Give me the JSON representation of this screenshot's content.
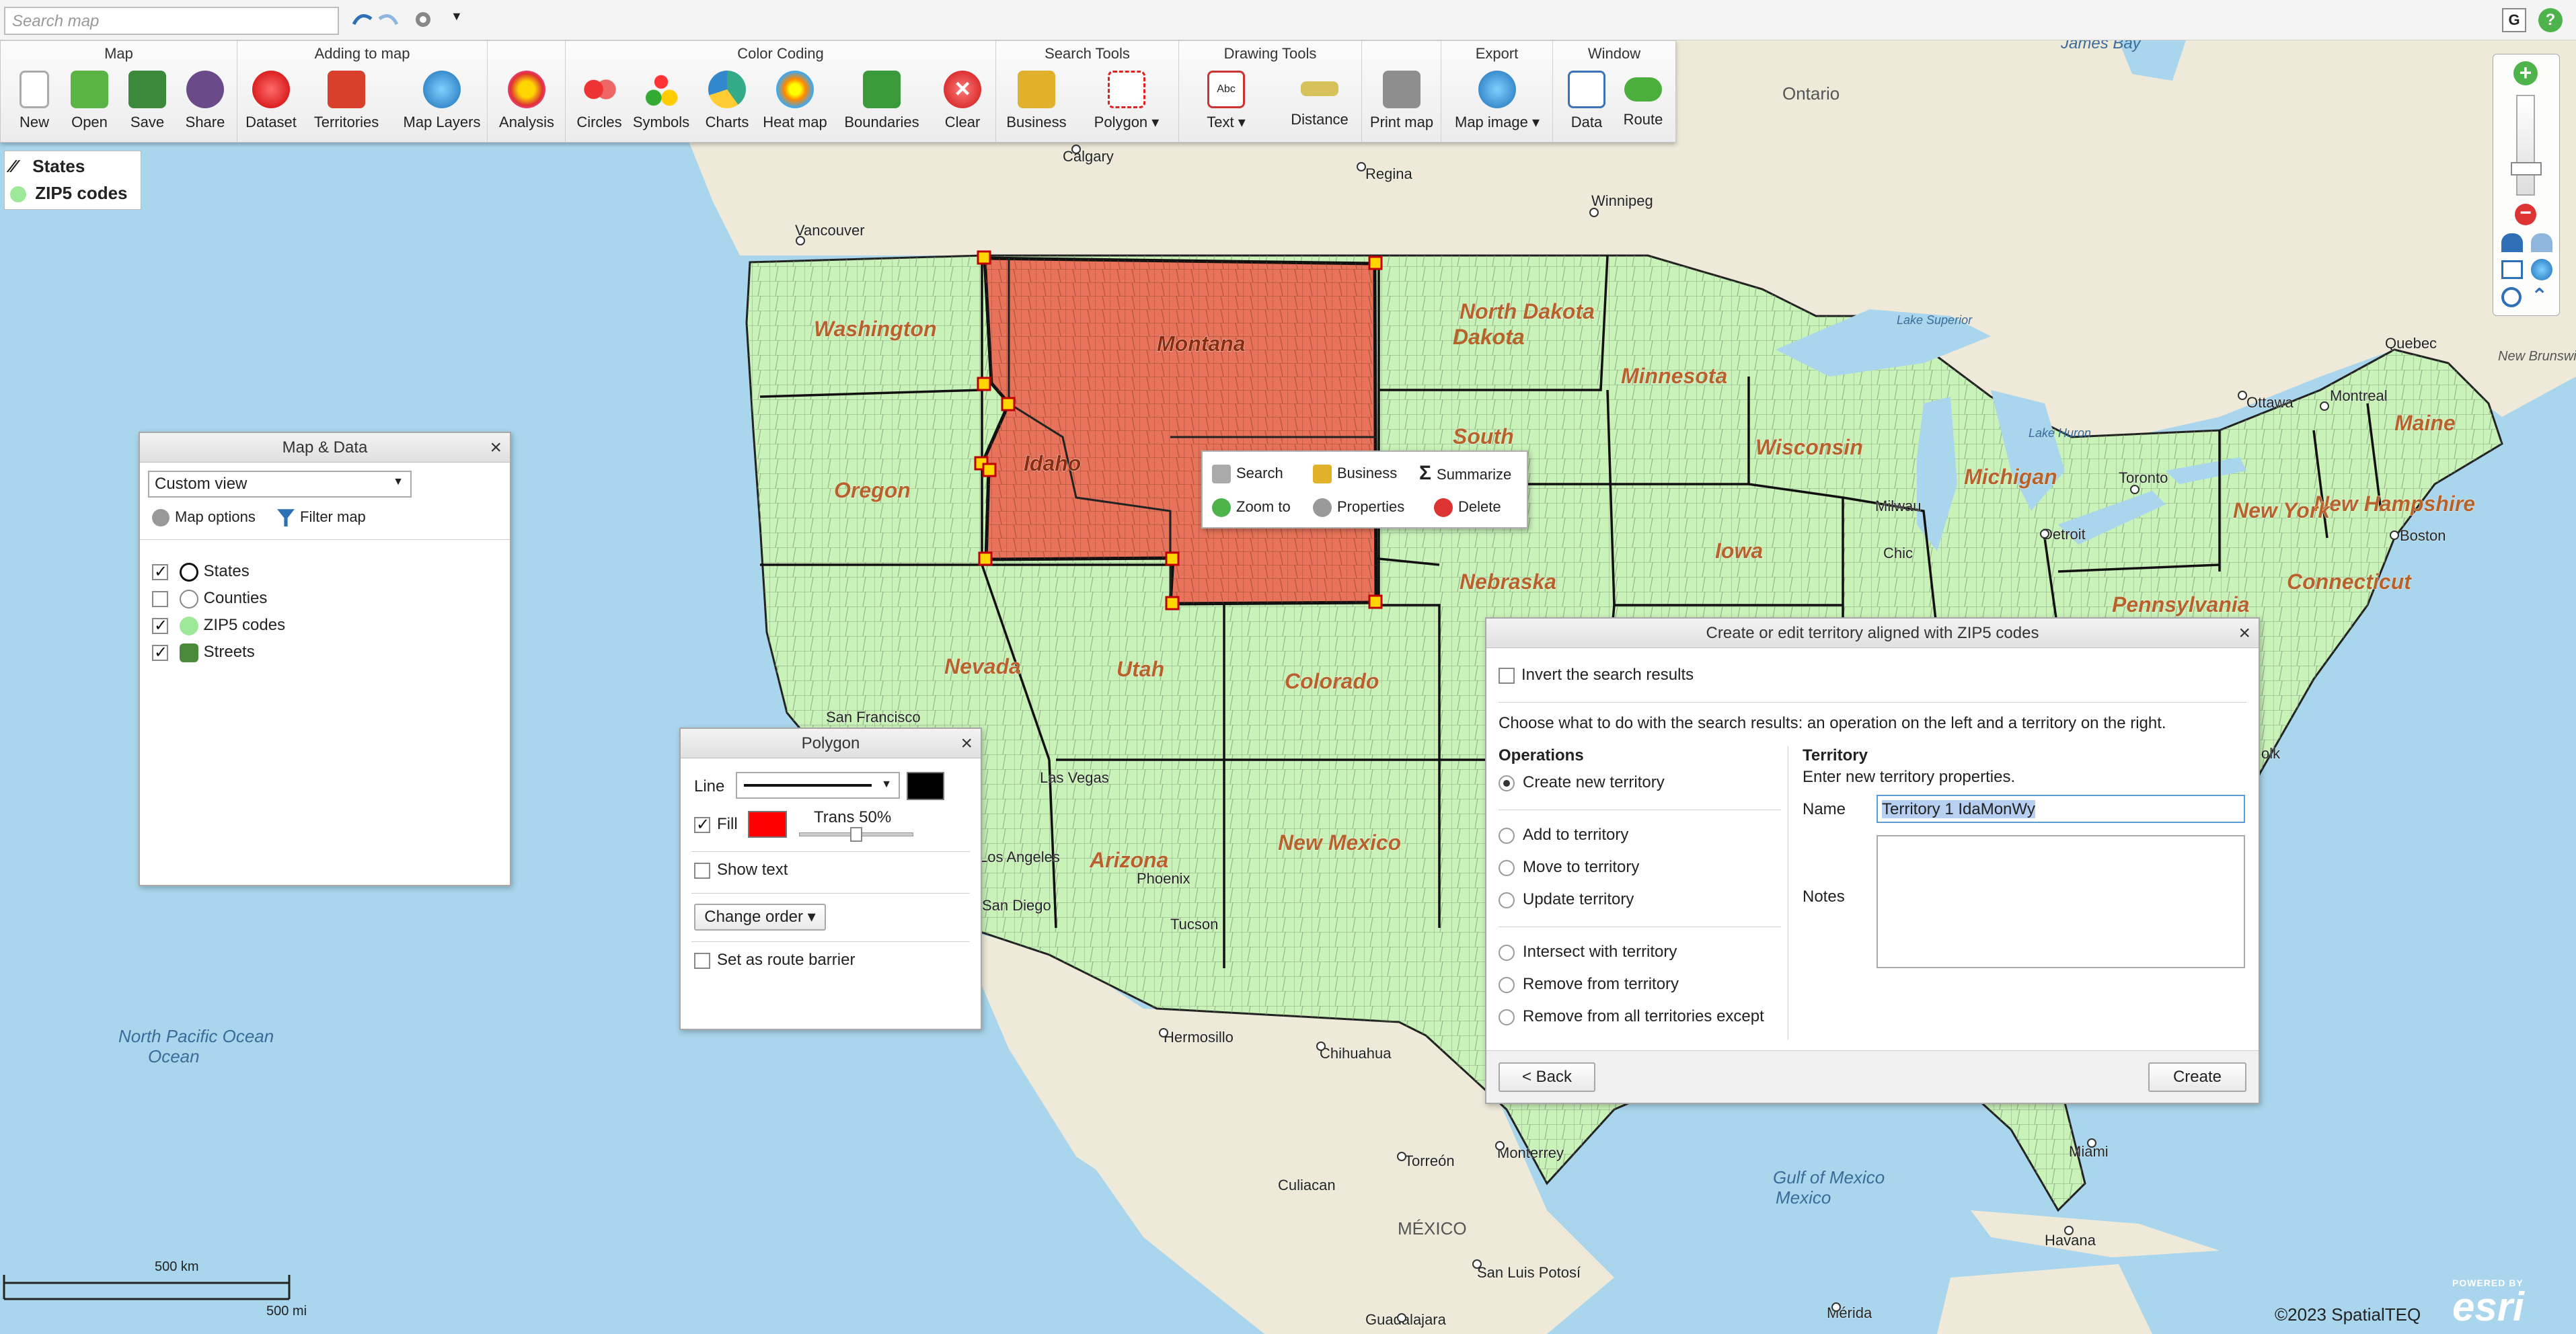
{
  "topbar": {
    "search_placeholder": "Search map",
    "right_button": "G",
    "help_button": "?"
  },
  "ribbon": {
    "groups": [
      {
        "title": "Map",
        "buttons": [
          "New",
          "Open",
          "Save",
          "Share"
        ]
      },
      {
        "title": "Adding to map",
        "buttons": [
          "Dataset",
          "Territories",
          "Map Layers"
        ]
      },
      {
        "title": "",
        "buttons": [
          "Analysis"
        ]
      },
      {
        "title": "Color Coding",
        "buttons": [
          "Circles",
          "Symbols",
          "Charts",
          "Heat map",
          "Boundaries",
          "Clear"
        ]
      },
      {
        "title": "Search Tools",
        "buttons": [
          "Business",
          "Polygon"
        ]
      },
      {
        "title": "Drawing Tools",
        "buttons": [
          "Text",
          "Distance"
        ]
      },
      {
        "title": "",
        "buttons": [
          "Print map"
        ]
      },
      {
        "title": "Export",
        "buttons": [
          "Map image"
        ]
      },
      {
        "title": "Window",
        "buttons": [
          "Data",
          "Route"
        ]
      }
    ]
  },
  "legend": {
    "items": [
      "States",
      "ZIP5 codes"
    ]
  },
  "map_labels": {
    "states": [
      "Washington",
      "Oregon",
      "Idaho",
      "Montana",
      "North Dakota",
      "South",
      "Minnesota",
      "Wisconsin",
      "Michigan",
      "Iowa",
      "Nebraska",
      "Nevada",
      "Utah",
      "Colorado",
      "Arizona",
      "New Mexico",
      "Maine",
      "New Hampshire",
      "New York",
      "Pennsylvania",
      "Connecticut"
    ],
    "cities": [
      "Calgary",
      "Regina",
      "Winnipeg",
      "Vancouver",
      "Ottawa",
      "Montreal",
      "Quebec",
      "Toronto",
      "Chic",
      "Milwau",
      "Detroit",
      "Boston",
      "Las Vegas",
      "Los Angeles",
      "San Diego",
      "Phoenix",
      "Tucson",
      "Hermosillo",
      "Chihuahua",
      "Culiacan",
      "Torreón",
      "Monterrey",
      "San Luis Potosí",
      "Guadalajara",
      "Mérida",
      "Havana",
      "Miami",
      "San Francisco",
      "olk"
    ],
    "regions": [
      "Ontario",
      "James Bay",
      "Lake Superior",
      "Lake Huron",
      "New Brunswick",
      "North Pacific Ocean",
      "Gulf of Mexico",
      "MÉXICO"
    ],
    "scale_km": "500 km",
    "scale_mi": "500 mi",
    "copyright": "©2023 SpatialTEQ",
    "powered_by": "POWERED BY",
    "esri": "esri"
  },
  "map_data_panel": {
    "title": "Map & Data",
    "view_select": "Custom view",
    "map_options": "Map options",
    "filter_map": "Filter map",
    "layers": [
      {
        "label": "States",
        "checked": true
      },
      {
        "label": "Counties",
        "checked": false
      },
      {
        "label": "ZIP5 codes",
        "checked": true
      },
      {
        "label": "Streets",
        "checked": true
      }
    ]
  },
  "polygon_panel": {
    "title": "Polygon",
    "line_label": "Line",
    "fill_label": "Fill",
    "trans_label": "Trans 50%",
    "trans_value": 0.5,
    "show_text": "Show text",
    "change_order": "Change order",
    "route_barrier": "Set as route barrier",
    "fill_color": "#ff0000",
    "line_color": "#000000"
  },
  "context_menu": {
    "items": [
      "Search",
      "Business",
      "Summarize",
      "Zoom to",
      "Properties",
      "Delete"
    ]
  },
  "territory_dialog": {
    "title": "Create or edit territory aligned with ZIP5 codes",
    "invert": "Invert the search results",
    "instruction": "Choose what to do with the search results: an operation on the left and a territory on the right.",
    "operations_heading": "Operations",
    "operations": [
      {
        "label": "Create new territory",
        "selected": true
      },
      {
        "label": "Add to territory",
        "selected": false
      },
      {
        "label": "Move to territory",
        "selected": false
      },
      {
        "label": "Update territory",
        "selected": false
      },
      {
        "label": "Intersect with territory",
        "selected": false
      },
      {
        "label": "Remove from territory",
        "selected": false
      },
      {
        "label": "Remove from all territories except",
        "selected": false
      }
    ],
    "territory_heading": "Territory",
    "territory_hint": "Enter new territory properties.",
    "name_label": "Name",
    "name_value": "Territory  1 IdaMonWy",
    "notes_label": "Notes",
    "back_button": "< Back",
    "create_button": "Create"
  },
  "colors": {
    "land_us": "#c9f2b9",
    "selected_territory": "#e8735a",
    "ocean": "#a9d6ec",
    "land_other": "#eee9d9",
    "accent_green": "#4eb34a"
  }
}
